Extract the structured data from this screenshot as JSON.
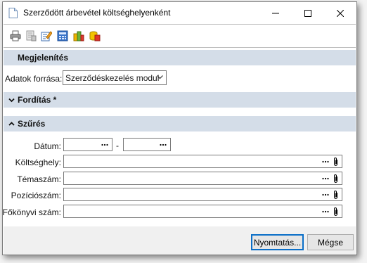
{
  "window": {
    "title": "Szerződött árbevétel költséghelyenként",
    "icons": [
      "app-document-icon",
      "minimize-icon",
      "maximize-icon",
      "close-icon"
    ]
  },
  "toolbar": {
    "items": [
      {
        "icon": "print-icon"
      },
      {
        "icon": "print-preview-icon"
      },
      {
        "icon": "edit-icon"
      },
      {
        "icon": "calculator-icon"
      },
      {
        "icon": "stacked-chart-icon"
      },
      {
        "icon": "export-icon"
      }
    ]
  },
  "sections": {
    "display": {
      "title": "Megjelenítés"
    },
    "translation": {
      "title": "Fordítás *"
    },
    "filter": {
      "title": "Szűrés"
    }
  },
  "display": {
    "source_label": "Adatok forrása:",
    "source_value": "Szerződéskezelés modul"
  },
  "filter": {
    "date_label": "Dátum:",
    "date_separator": "-",
    "cost_center_label": "Költséghely:",
    "topic_label": "Témaszám:",
    "position_label": "Pozíciószám:",
    "ledger_label": "Főkönyvi szám:"
  },
  "buttons": {
    "print": "Nyomtatás...",
    "cancel": "Mégse"
  },
  "colors": {
    "section_header": "#d4dde8",
    "default_button_border": "#0b6fc8"
  }
}
